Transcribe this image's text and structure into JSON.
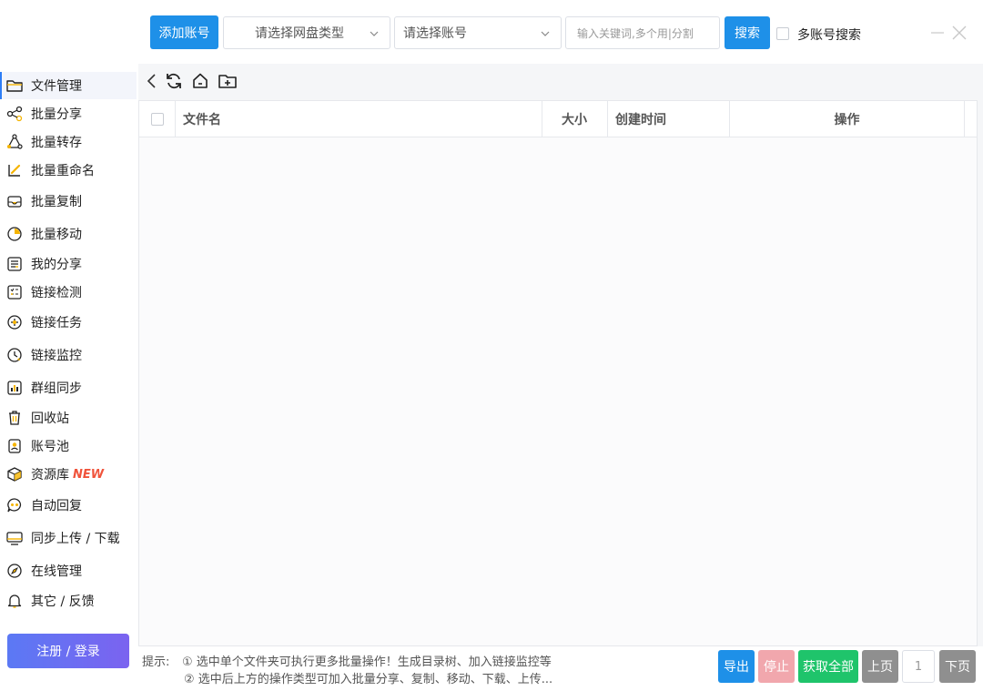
{
  "header": {
    "add_account_label": "添加账号",
    "drive_type_select": "请选择网盘类型",
    "account_select": "请选择账号",
    "keyword_placeholder": "输入关键词,多个用|分割",
    "search_label": "搜索",
    "multi_account_label": "多账号搜索"
  },
  "sidebar": {
    "items": [
      {
        "label": "文件管理",
        "icon": "folder-icon"
      },
      {
        "label": "批量分享",
        "icon": "share-icon"
      },
      {
        "label": "批量转存",
        "icon": "transfer-icon"
      },
      {
        "label": "批量重命名",
        "icon": "rename-icon"
      },
      {
        "label": "批量复制",
        "icon": "copy-icon"
      },
      {
        "label": "批量移动",
        "icon": "move-icon"
      },
      {
        "label": "我的分享",
        "icon": "my-share-icon"
      },
      {
        "label": "链接检测",
        "icon": "link-check-icon"
      },
      {
        "label": "链接任务",
        "icon": "link-task-icon"
      },
      {
        "label": "链接监控",
        "icon": "link-monitor-icon"
      },
      {
        "label": "群组同步",
        "icon": "group-sync-icon"
      },
      {
        "label": "回收站",
        "icon": "trash-icon"
      },
      {
        "label": "账号池",
        "icon": "account-pool-icon"
      },
      {
        "label": "资源库",
        "icon": "resource-icon",
        "badge": "NEW"
      },
      {
        "label": "自动回复",
        "icon": "auto-reply-icon"
      },
      {
        "label": "同步上传 / 下载",
        "icon": "sync-upload-icon"
      },
      {
        "label": "在线管理",
        "icon": "compass-icon"
      },
      {
        "label": "其它 / 反馈",
        "icon": "bell-icon"
      }
    ],
    "login_label": "注册 / 登录"
  },
  "table": {
    "columns": [
      "文件名",
      "大小",
      "创建时间",
      "操作"
    ]
  },
  "footer": {
    "hint_prefix": "提示:",
    "hint_1": "① 选中单个文件夹可执行更多批量操作！生成目录树、加入链接监控等",
    "hint_2": "② 选中后上方的操作类型可加入批量分享、复制、移动、下载、上传...",
    "export_label": "导出",
    "stop_label": "停止",
    "fetch_all_label": "获取全部",
    "prev_label": "上页",
    "page_value": "1",
    "next_label": "下页"
  },
  "colors": {
    "primary": "#1e90e8",
    "green": "#1fc46b",
    "stop_disabled": "#f1a7ad",
    "gray_button": "#8f8f8f",
    "new_badge": "#f0533b"
  }
}
